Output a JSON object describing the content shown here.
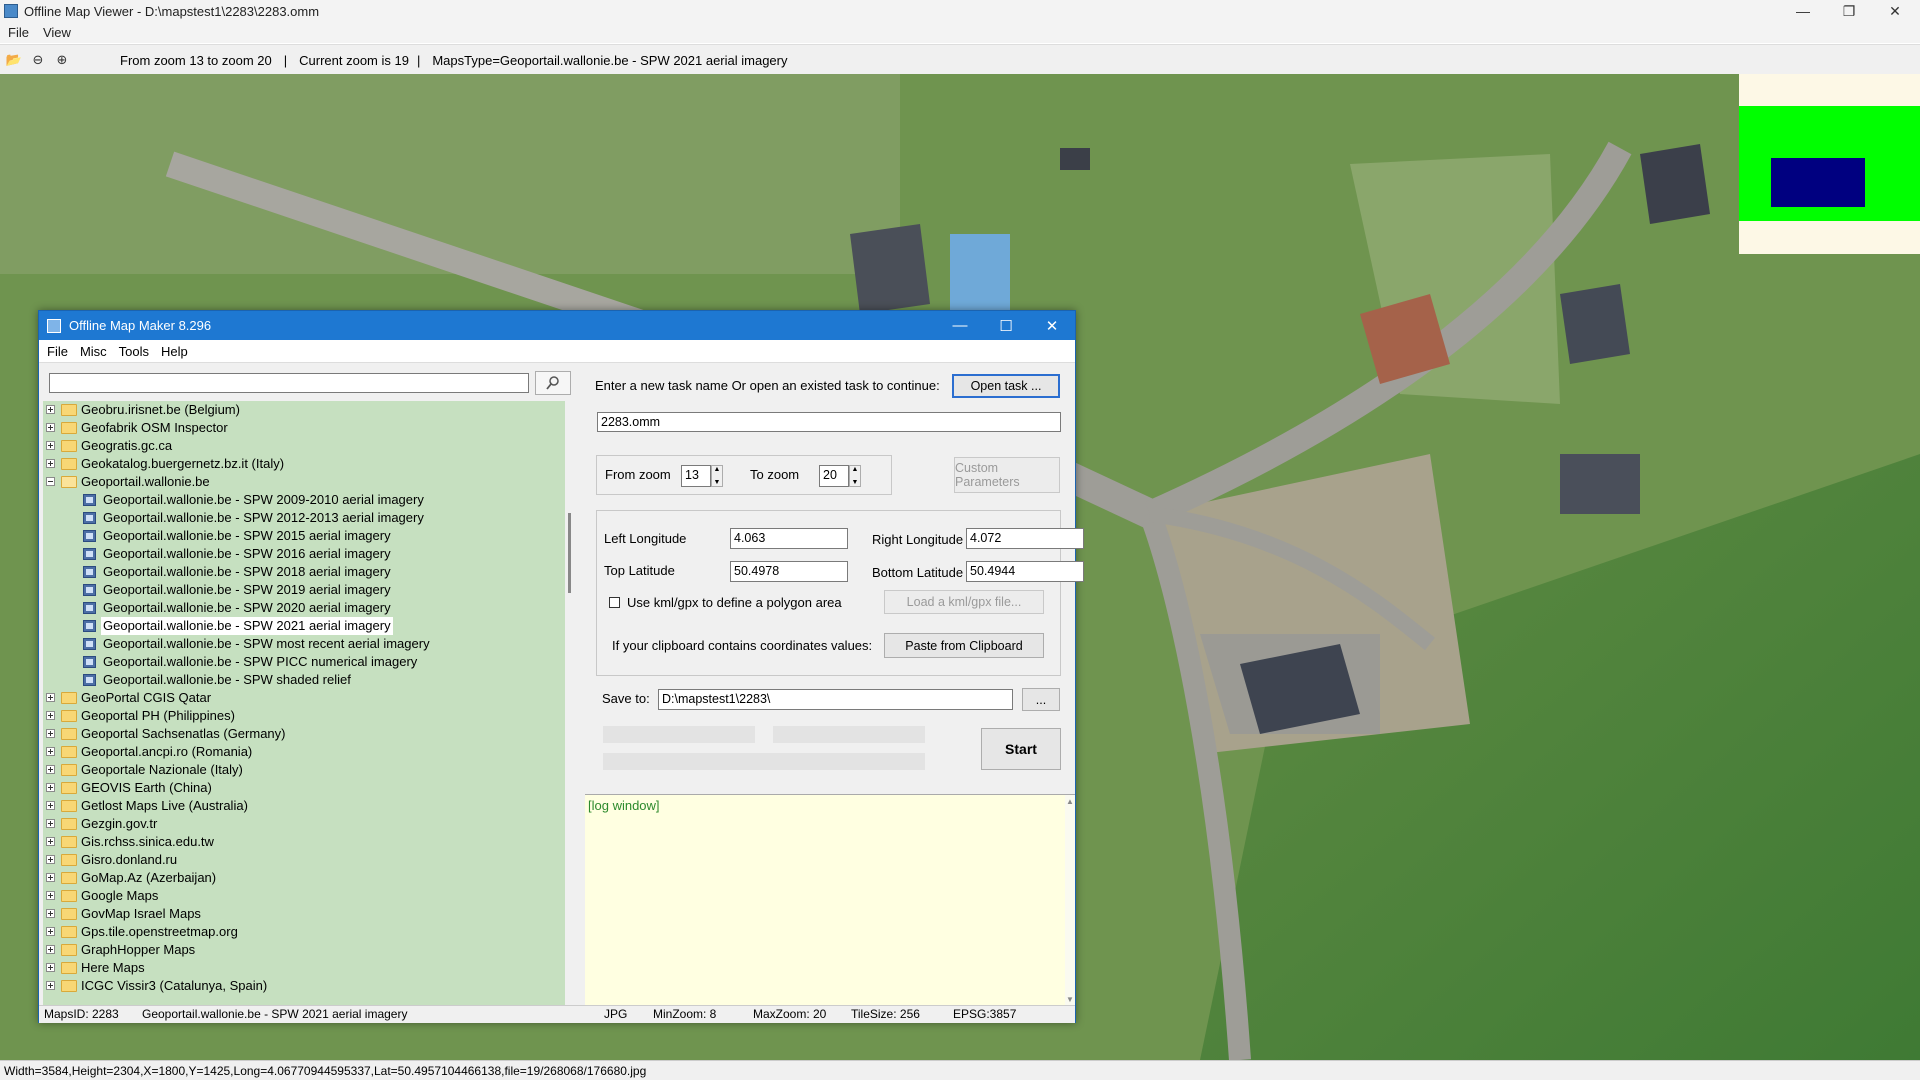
{
  "viewer": {
    "title": "Offline Map Viewer - D:\\mapstest1\\2283\\2283.omm",
    "menu": [
      "File",
      "View"
    ],
    "toolbar": {
      "zoom_range": "From zoom 13 to zoom 20",
      "current_zoom": "Current zoom is 19",
      "maps_type": "MapsType=Geoportail.wallonie.be - SPW 2021 aerial imagery"
    },
    "status": "Width=3584,Height=2304,X=1800,Y=1425,Long=4.06770944595337,Lat=50.4957104466138,file=19/268068/176680.jpg"
  },
  "maker": {
    "title": "Offline Map Maker 8.296",
    "menu": [
      "File",
      "Misc",
      "Tools",
      "Help"
    ],
    "search": {
      "value": "",
      "placeholder": ""
    },
    "tree": [
      {
        "label": "Geobru.irisnet.be (Belgium)",
        "type": "folder",
        "expanded": false
      },
      {
        "label": "Geofabrik OSM Inspector",
        "type": "folder",
        "expanded": false
      },
      {
        "label": "Geogratis.gc.ca",
        "type": "folder",
        "expanded": false
      },
      {
        "label": "Geokatalog.buergernetz.bz.it (Italy)",
        "type": "folder",
        "expanded": false
      },
      {
        "label": "Geoportail.wallonie.be",
        "type": "folder",
        "expanded": true
      },
      {
        "label": "Geoportail.wallonie.be - SPW 2009-2010 aerial imagery",
        "type": "map"
      },
      {
        "label": "Geoportail.wallonie.be - SPW 2012-2013 aerial imagery",
        "type": "map"
      },
      {
        "label": "Geoportail.wallonie.be - SPW 2015 aerial imagery",
        "type": "map"
      },
      {
        "label": "Geoportail.wallonie.be - SPW 2016 aerial imagery",
        "type": "map"
      },
      {
        "label": "Geoportail.wallonie.be - SPW 2018 aerial imagery",
        "type": "map"
      },
      {
        "label": "Geoportail.wallonie.be - SPW 2019 aerial imagery",
        "type": "map"
      },
      {
        "label": "Geoportail.wallonie.be - SPW 2020 aerial imagery",
        "type": "map"
      },
      {
        "label": "Geoportail.wallonie.be - SPW 2021 aerial imagery",
        "type": "map",
        "selected": true
      },
      {
        "label": "Geoportail.wallonie.be - SPW most recent aerial imagery",
        "type": "map"
      },
      {
        "label": "Geoportail.wallonie.be - SPW PICC numerical imagery",
        "type": "map"
      },
      {
        "label": "Geoportail.wallonie.be - SPW shaded relief",
        "type": "map"
      },
      {
        "label": "GeoPortal CGIS Qatar",
        "type": "folder",
        "expanded": false
      },
      {
        "label": "Geoportal PH (Philippines)",
        "type": "folder",
        "expanded": false
      },
      {
        "label": "Geoportal Sachsenatlas (Germany)",
        "type": "folder",
        "expanded": false
      },
      {
        "label": "Geoportal.ancpi.ro (Romania)",
        "type": "folder",
        "expanded": false
      },
      {
        "label": "Geoportale Nazionale (Italy)",
        "type": "folder",
        "expanded": false
      },
      {
        "label": "GEOVIS Earth (China)",
        "type": "folder",
        "expanded": false
      },
      {
        "label": "Getlost Maps Live (Australia)",
        "type": "folder",
        "expanded": false
      },
      {
        "label": "Gezgin.gov.tr",
        "type": "folder",
        "expanded": false
      },
      {
        "label": "Gis.rchss.sinica.edu.tw",
        "type": "folder",
        "expanded": false
      },
      {
        "label": "Gisro.donland.ru",
        "type": "folder",
        "expanded": false
      },
      {
        "label": "GoMap.Az (Azerbaijan)",
        "type": "folder",
        "expanded": false
      },
      {
        "label": "Google Maps",
        "type": "folder",
        "expanded": false
      },
      {
        "label": "GovMap Israel Maps",
        "type": "folder",
        "expanded": false
      },
      {
        "label": "Gps.tile.openstreetmap.org",
        "type": "folder",
        "expanded": false
      },
      {
        "label": "GraphHopper Maps",
        "type": "folder",
        "expanded": false
      },
      {
        "label": "Here Maps",
        "type": "folder",
        "expanded": false
      },
      {
        "label": "ICGC Vissir3 (Catalunya, Spain)",
        "type": "folder",
        "expanded": false
      }
    ],
    "task": {
      "prompt": "Enter a new task name Or open an existed task to continue:",
      "open_button": "Open task ...",
      "name": "2283.omm"
    },
    "zoom": {
      "from_label": "From zoom",
      "from_value": "13",
      "to_label": "To zoom",
      "to_value": "20",
      "custom_button": "Custom Parameters"
    },
    "coords": {
      "left_label": "Left Longitude",
      "left_value": "4.063",
      "right_label": "Right Longitude",
      "right_value": "4.072",
      "top_label": "Top Latitude",
      "top_value": "50.4978",
      "bottom_label": "Bottom Latitude",
      "bottom_value": "50.4944",
      "kml_label": "Use kml/gpx to define a polygon area",
      "kml_button": "Load a kml/gpx file...",
      "clipboard_label": "If your clipboard contains coordinates values:",
      "clipboard_button": "Paste from Clipboard"
    },
    "save": {
      "label": "Save to:",
      "path": "D:\\mapstest1\\2283\\",
      "browse": "...",
      "start": "Start"
    },
    "log": "[log window]",
    "status": {
      "maps_id": "MapsID: 2283",
      "maps_name": "Geoportail.wallonie.be - SPW 2021 aerial imagery",
      "format": "JPG",
      "min_zoom": "MinZoom: 8",
      "max_zoom": "MaxZoom: 20",
      "tile_size": "TileSize: 256",
      "epsg": "EPSG:3857"
    }
  },
  "colors": {
    "maker_titlebar": "#1e78d2",
    "tree_bg": "#c6e0c0",
    "log_bg": "#ffffe1",
    "minimap_green": "#00ff00",
    "minimap_blue": "#000080"
  }
}
